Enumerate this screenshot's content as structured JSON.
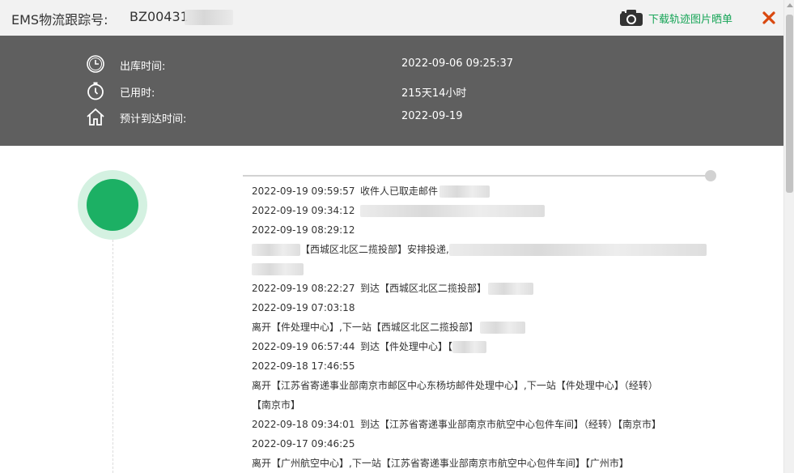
{
  "header": {
    "label": "EMS物流跟踪号:",
    "tracking_prefix": "BZ00431",
    "download_label": "下载轨迹图片晒单"
  },
  "summary": {
    "outbound_label": "出库时间:",
    "outbound_value": "2022-09-06 09:25:37",
    "elapsed_label": "已用时:",
    "elapsed_value": "215天14小时",
    "eta_label": "预计到达时间:",
    "eta_value": "2022-09-19"
  },
  "events": [
    {
      "time": "2022-09-19 09:59:57",
      "desc": "收件人已取走邮件"
    },
    {
      "time": "2022-09-19 09:34:12",
      "desc": ""
    },
    {
      "time": "2022-09-19 08:29:12",
      "desc": ""
    },
    {
      "desc_line": "【西城区北区二揽投部】安排投递,"
    },
    {
      "time": "2022-09-19 08:22:27",
      "desc": "到达【西城区北区二揽投部】"
    },
    {
      "time": "2022-09-19 07:03:18",
      "desc": ""
    },
    {
      "desc_line": "离开【件处理中心】,下一站【西城区北区二揽投部】"
    },
    {
      "time": "2022-09-19 06:57:44",
      "desc": "到达【件处理中心】【"
    },
    {
      "time": "2022-09-18 17:46:55",
      "desc": ""
    },
    {
      "desc_line": "离开【江苏省寄递事业部南京市邮区中心东杨坊邮件处理中心】,下一站【件处理中心】（经转）"
    },
    {
      "desc_line": "【南京市】"
    },
    {
      "time": "2022-09-18 09:34:01",
      "desc": "到达【江苏省寄递事业部南京市航空中心包件车间】（经转）【南京市】"
    },
    {
      "time": "2022-09-17 09:46:25",
      "desc": ""
    },
    {
      "desc_line": "离开【广州航空中心】,下一站【江苏省寄递事业部南京市航空中心包件车间】【广州市】"
    }
  ],
  "colors": {
    "accent_green": "#1cb064",
    "close_red": "#d9480f",
    "panel_bg": "#5f5f5f"
  },
  "icons": [
    "camera-icon",
    "close-icon",
    "clock-icon",
    "stopwatch-icon",
    "home-icon"
  ]
}
